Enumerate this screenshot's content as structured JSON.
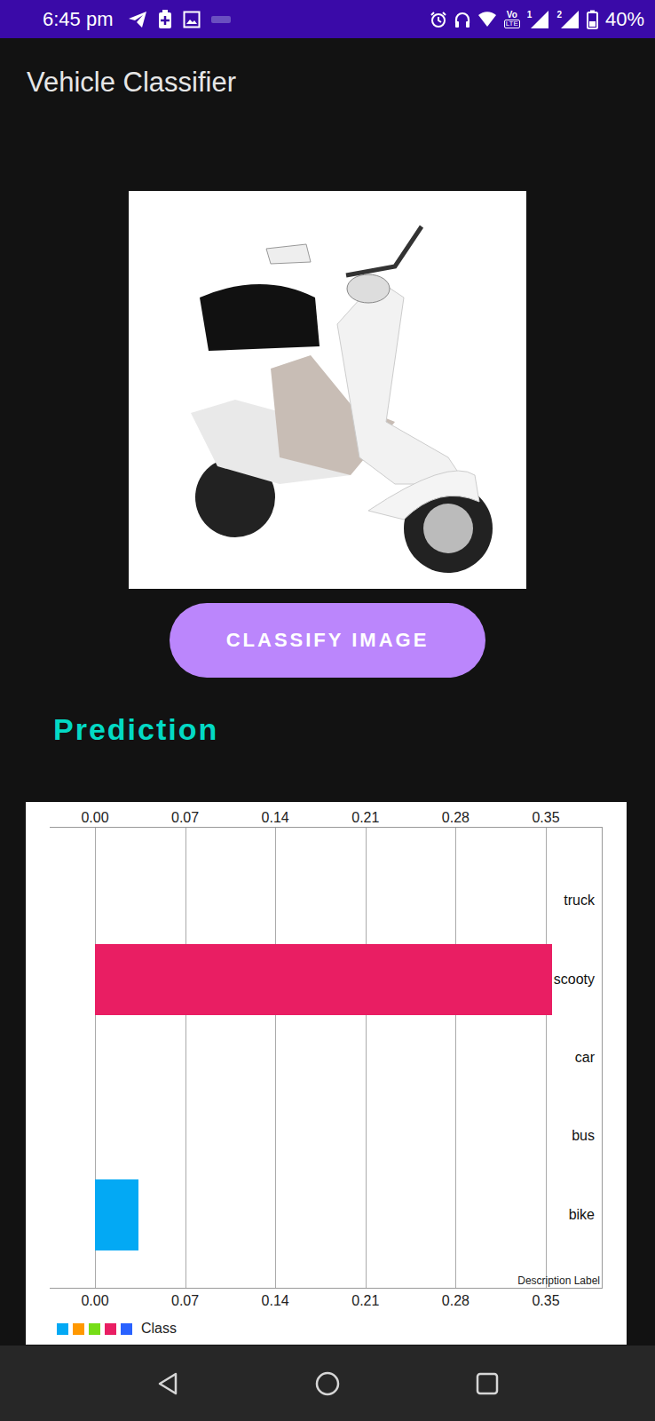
{
  "status_bar": {
    "time": "6:45 pm",
    "volte": "Vo",
    "lte": "LTE",
    "sim1": "1",
    "sim2": "2",
    "battery": "40%"
  },
  "app_bar": {
    "title": "Vehicle Classifier"
  },
  "classify_button": {
    "label": "CLASSIFY IMAGE"
  },
  "prediction": {
    "title": "Prediction"
  },
  "chart": {
    "ticks": [
      "0.00",
      "0.07",
      "0.14",
      "0.21",
      "0.28",
      "0.35"
    ],
    "series": [
      {
        "label": "bike",
        "value": 0.034,
        "color": "#03a9f4"
      },
      {
        "label": "bus",
        "value": 0,
        "color": "#ff9800"
      },
      {
        "label": "car",
        "value": 0,
        "color": "#76dd17"
      },
      {
        "label": "scooty",
        "value": 0.355,
        "color": "#e91e63"
      },
      {
        "label": "truck",
        "value": 0,
        "color": "#2962ff"
      }
    ],
    "axis_label": "Description Label",
    "legend": {
      "label": "Class"
    }
  }
}
